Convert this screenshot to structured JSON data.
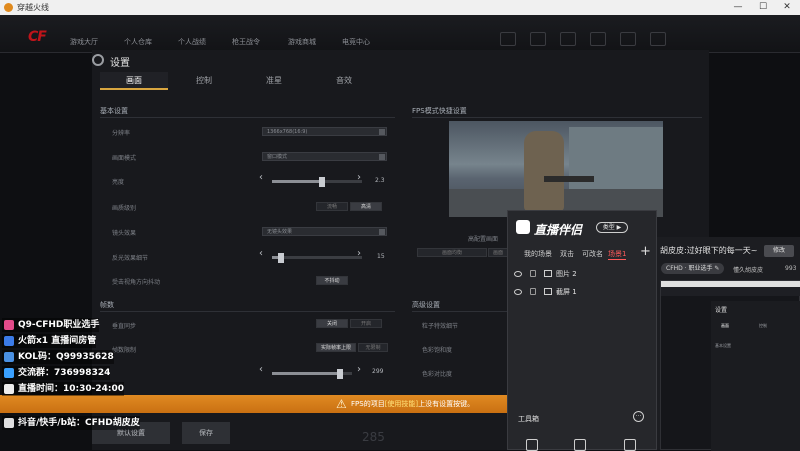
{
  "window": {
    "title": "穿越火线",
    "controls": [
      "—",
      "☐",
      "✕"
    ]
  },
  "gamebar": {
    "logo": "CF",
    "nav": [
      "游戏大厅",
      "个人仓库",
      "个人战绩",
      "枪王战令",
      "游戏商城",
      "电竞中心"
    ]
  },
  "settings": {
    "title": "设置",
    "tabs": [
      {
        "label": "画面",
        "active": true
      },
      {
        "label": "控制",
        "active": false
      },
      {
        "label": "准星",
        "active": false
      },
      {
        "label": "音效",
        "active": false
      }
    ],
    "basic_title": "基本设置",
    "basic_rows": [
      {
        "label": "分辨率",
        "value": "1366x768(16:9)"
      },
      {
        "label": "画面模式",
        "value": "窗口模式"
      },
      {
        "label": "亮度",
        "value": "2.3",
        "level": 0.55
      },
      {
        "label": "画质级别",
        "options": [
          "流畅",
          "高清"
        ]
      },
      {
        "label": "镜头效果",
        "value": "无镜头效果"
      },
      {
        "label": "反光效果细节",
        "value": "15",
        "level": 0.1
      },
      {
        "label": "受击视角方向抖动",
        "options": [
          "不抖动"
        ]
      }
    ],
    "fps_title": "FPS模式快捷设置",
    "fps_sub": "高配置画面",
    "fps_options": [
      "画面均衡",
      "画面"
    ],
    "frames_title": "帧数",
    "frames_rows": [
      {
        "label": "垂直同步",
        "options": [
          "关闭",
          "开启"
        ]
      },
      {
        "label": "帧数限制",
        "options": [
          "实际帧率上限",
          "无限制"
        ]
      },
      {
        "label": "",
        "value": "299",
        "level": 0.85
      }
    ],
    "advanced_title": "高级设置",
    "advanced_rows": [
      "粒子特效细节",
      "色彩饱和度",
      "色彩对比度"
    ],
    "bottom_buttons": [
      "默认设置",
      "保存"
    ],
    "overlay_number": "285"
  },
  "notice": {
    "text_before": "FPS的项目",
    "text_highlight": "[使用技能]",
    "text_after": "上没有设置按键。"
  },
  "streamer_overlay": [
    "Q9-CFHD职业选手",
    "火箭x1  直播间房管",
    "KOL码：Q99935628",
    "交流群：736998324",
    "直播时间：10:30-24:00",
    "抖音/快手/b站：CFHD胡皮皮"
  ],
  "live_app": {
    "brand": "直播伴侣",
    "type_button": "类型 ▶",
    "scene_tabs": [
      {
        "label": "我的场景",
        "active": false
      },
      {
        "label": "双击",
        "active": false
      },
      {
        "label": "可改名",
        "active": false
      },
      {
        "label": "场景1",
        "active": true
      }
    ],
    "plus": "+",
    "layers": [
      {
        "name": "图片 2"
      },
      {
        "name": "截屏 1"
      }
    ],
    "tools_label": "工具箱",
    "more": "···"
  },
  "room": {
    "title": "胡皮皮:过好眼下的每一天~",
    "modify_button": "修改",
    "tag": "CFHD · 职业选手 ✎",
    "sub": "懂久胡皮皮",
    "count": "993"
  },
  "thumb": {
    "settings_title": "设置",
    "tabs": [
      "画面",
      "控制"
    ],
    "section": "基本设置"
  }
}
